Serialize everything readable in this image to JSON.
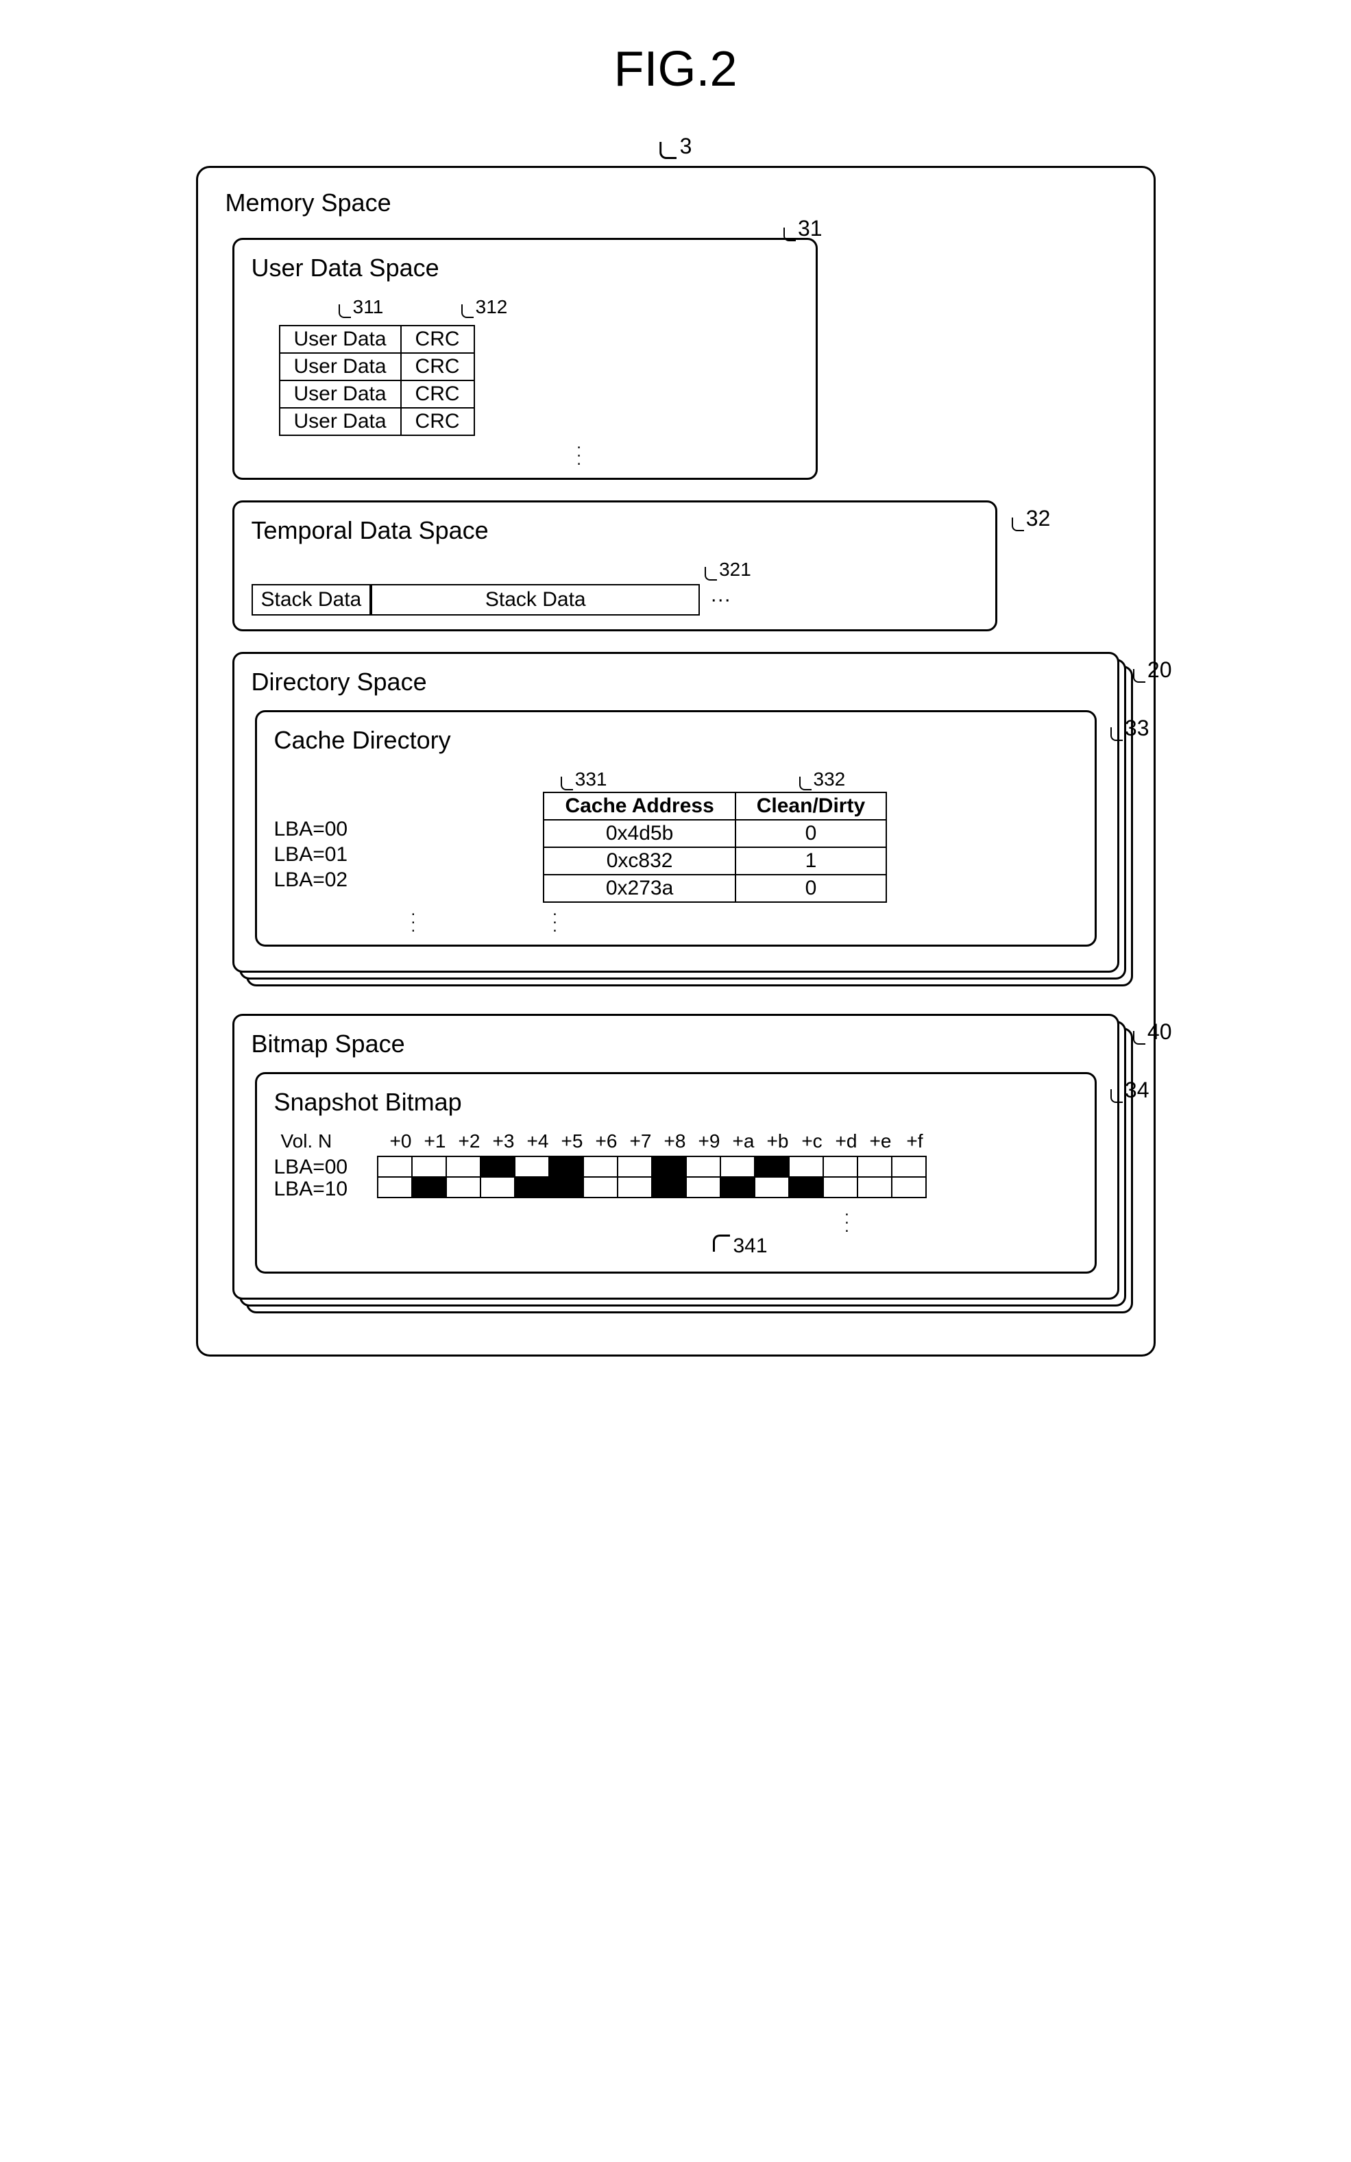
{
  "figure_title": "FIG.2",
  "memory_space": {
    "ref": "3",
    "label": "Memory Space"
  },
  "user_data_space": {
    "ref": "31",
    "label": "User Data Space",
    "col_refs": {
      "data": "311",
      "crc": "312"
    },
    "rows": [
      {
        "data": "User Data",
        "crc": "CRC"
      },
      {
        "data": "User Data",
        "crc": "CRC"
      },
      {
        "data": "User Data",
        "crc": "CRC"
      },
      {
        "data": "User Data",
        "crc": "CRC"
      }
    ]
  },
  "temporal_data_space": {
    "ref": "32",
    "label": "Temporal Data Space",
    "stack_ref": "321",
    "cells": [
      "Stack Data",
      "Stack Data"
    ]
  },
  "directory_space": {
    "ref": "20",
    "label": "Directory Space",
    "cache_directory": {
      "ref": "33",
      "label": "Cache Directory",
      "col_refs": {
        "addr": "331",
        "cd": "332"
      },
      "headers": {
        "addr": "Cache Address",
        "cd": "Clean/Dirty"
      },
      "rows": [
        {
          "lba": "LBA=00",
          "addr": "0x4d5b",
          "cd": "0"
        },
        {
          "lba": "LBA=01",
          "addr": "0xc832",
          "cd": "1"
        },
        {
          "lba": "LBA=02",
          "addr": "0x273a",
          "cd": "0"
        }
      ]
    }
  },
  "bitmap_space": {
    "ref": "40",
    "label": "Bitmap Space",
    "snapshot_bitmap": {
      "ref": "34",
      "label": "Snapshot Bitmap",
      "cell_ref": "341",
      "vol_label": "Vol. N",
      "offsets": [
        "+0",
        "+1",
        "+2",
        "+3",
        "+4",
        "+5",
        "+6",
        "+7",
        "+8",
        "+9",
        "+a",
        "+b",
        "+c",
        "+d",
        "+e",
        "+f"
      ],
      "rows": [
        {
          "lba": "LBA=00",
          "bits": [
            0,
            0,
            0,
            1,
            0,
            1,
            0,
            0,
            1,
            0,
            0,
            1,
            0,
            0,
            0,
            0
          ]
        },
        {
          "lba": "LBA=10",
          "bits": [
            0,
            1,
            0,
            0,
            1,
            1,
            0,
            0,
            1,
            0,
            1,
            0,
            1,
            0,
            0,
            0
          ]
        }
      ]
    }
  },
  "chart_data": {
    "type": "table",
    "title": "FIG.2 — Memory Space layout",
    "sections": [
      {
        "name": "User Data Space",
        "ref": 31,
        "columns": [
          {
            "name": "User Data",
            "ref": 311
          },
          {
            "name": "CRC",
            "ref": 312
          }
        ],
        "row_count": 4
      },
      {
        "name": "Temporal Data Space",
        "ref": 32,
        "element": "Stack Data",
        "element_ref": 321
      },
      {
        "name": "Directory Space",
        "ref": 20,
        "child": {
          "name": "Cache Directory",
          "ref": 33,
          "columns": [
            {
              "name": "Cache Address",
              "ref": 331
            },
            {
              "name": "Clean/Dirty",
              "ref": 332
            }
          ],
          "rows": [
            {
              "LBA": "00",
              "Cache Address": "0x4d5b",
              "Clean/Dirty": 0
            },
            {
              "LBA": "01",
              "Cache Address": "0xc832",
              "Clean/Dirty": 1
            },
            {
              "LBA": "02",
              "Cache Address": "0x273a",
              "Clean/Dirty": 0
            }
          ]
        }
      },
      {
        "name": "Bitmap Space",
        "ref": 40,
        "child": {
          "name": "Snapshot Bitmap",
          "ref": 34,
          "cell_ref": 341,
          "vol": "N",
          "offsets": [
            "+0",
            "+1",
            "+2",
            "+3",
            "+4",
            "+5",
            "+6",
            "+7",
            "+8",
            "+9",
            "+a",
            "+b",
            "+c",
            "+d",
            "+e",
            "+f"
          ],
          "rows": {
            "LBA=00": [
              0,
              0,
              0,
              1,
              0,
              1,
              0,
              0,
              1,
              0,
              0,
              1,
              0,
              0,
              0,
              0
            ],
            "LBA=10": [
              0,
              1,
              0,
              0,
              1,
              1,
              0,
              0,
              1,
              0,
              1,
              0,
              1,
              0,
              0,
              0
            ]
          }
        }
      }
    ]
  }
}
